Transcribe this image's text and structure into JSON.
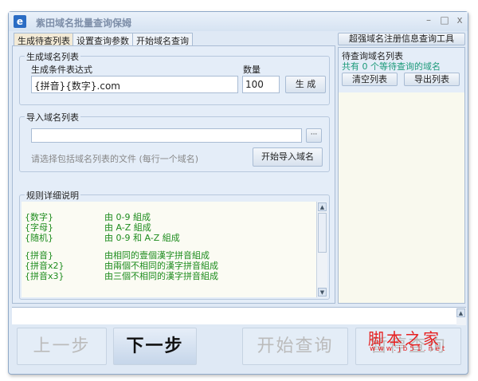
{
  "window": {
    "title": "紫田域名批量查询保姆",
    "minimize": "–",
    "maximize": "□",
    "close": "x"
  },
  "tabs": [
    {
      "label": "生成待查列表",
      "active": true
    },
    {
      "label": "设置查询参数"
    },
    {
      "label": "开始域名查询"
    }
  ],
  "generate": {
    "group_label": "生成域名列表",
    "expr_label": "生成条件表达式",
    "expr_value": "{拼音}{数字}.com",
    "count_label": "数量",
    "count_value": "100",
    "button": "生 成"
  },
  "import": {
    "group_label": "导入域名列表",
    "file_value": "",
    "browse": "···",
    "hint": "请选择包括域名列表的文件 (每行一个域名)",
    "button": "开始导入域名"
  },
  "rules": {
    "group_label": "规则详细说明",
    "items": [
      {
        "key": "{数字}",
        "desc": "由 0-9 組成"
      },
      {
        "key": "{字母}",
        "desc": "由 A-Z 組成"
      },
      {
        "key": "{随机}",
        "desc": "由 0-9 和 A-Z 組成"
      },
      {
        "key": "{拼音}",
        "desc": "由相同的壹個漢字拼音組成"
      },
      {
        "key": "{拼音x2}",
        "desc": "由兩個不相同的漢字拼音組成"
      },
      {
        "key": "{拼音x3}",
        "desc": "由三個不相同的漢字拼音組成"
      }
    ]
  },
  "right": {
    "tool_button": "超强域名注册信息查询工具",
    "group_label": "待查询域名列表",
    "count_text": "共有 0 个等待查询的域名",
    "clear": "清空列表",
    "export": "导出列表"
  },
  "bottom": {
    "prev": "上一步",
    "next": "下一步",
    "start": "开始查询",
    "pause": "暂停查询"
  },
  "watermark": {
    "text": "脚本之家",
    "url": "www.jb51.net"
  }
}
